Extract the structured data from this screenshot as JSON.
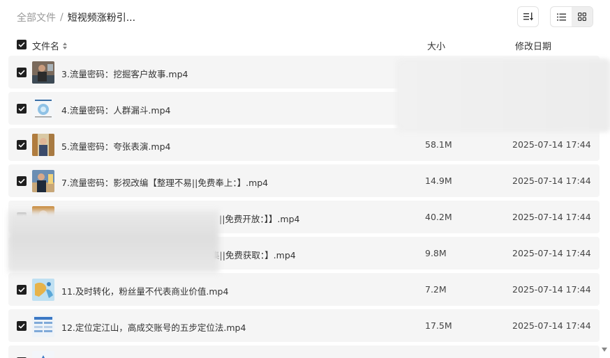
{
  "breadcrumb": {
    "root": "全部文件",
    "separator": "/",
    "current": "短视频涨粉引..."
  },
  "header": {
    "name": "文件名",
    "size": "大小",
    "date": "修改日期"
  },
  "files": [
    {
      "name": "3.流量密码：挖掘客户故事.mp4",
      "size": "",
      "date": "",
      "thumb": "person-dark"
    },
    {
      "name": "4.流量密码：人群漏斗.mp4",
      "size": "",
      "date": "",
      "thumb": "funnel-chart"
    },
    {
      "name": "5.流量密码：夸张表演.mp4",
      "size": "58.1M",
      "date": "2025-07-14 17:44",
      "thumb": "person-yellow"
    },
    {
      "name": "7.流量密码：影视改编【整理不易||免费奉上：】.mp4",
      "size": "14.9M",
      "date": "2025-07-14 17:44",
      "thumb": "person-blue"
    },
    {
      "name": "||免费开放：】】.mp4",
      "size": "40.2M",
      "date": "2025-07-14 17:44",
      "thumb": "person-orange"
    },
    {
      "name": "集||免费获取：】.mp4",
      "size": "9.8M",
      "date": "2025-07-14 17:44",
      "thumb": "person-grey"
    },
    {
      "name": "11.及时转化，粉丝量不代表商业价值.mp4",
      "size": "7.2M",
      "date": "2025-07-14 17:44",
      "thumb": "map-blue"
    },
    {
      "name": "12.定位定江山，高成交账号的五步定位法.mp4",
      "size": "17.5M",
      "date": "2025-07-14 17:44",
      "thumb": "slide-table"
    },
    {
      "name": "",
      "size": "",
      "date": "",
      "thumb": "slide-blue"
    }
  ],
  "colors": {
    "row_bg": "#f5f5f5",
    "checkbox": "#1f1f1f",
    "muted_text": "#999999"
  },
  "icons": {
    "sort": "sort-lines-icon",
    "list_view": "list-view-icon",
    "grid_view": "grid-view-icon",
    "header_sort": "sort-updown-icon",
    "scroll": "scroll-down-icon"
  }
}
